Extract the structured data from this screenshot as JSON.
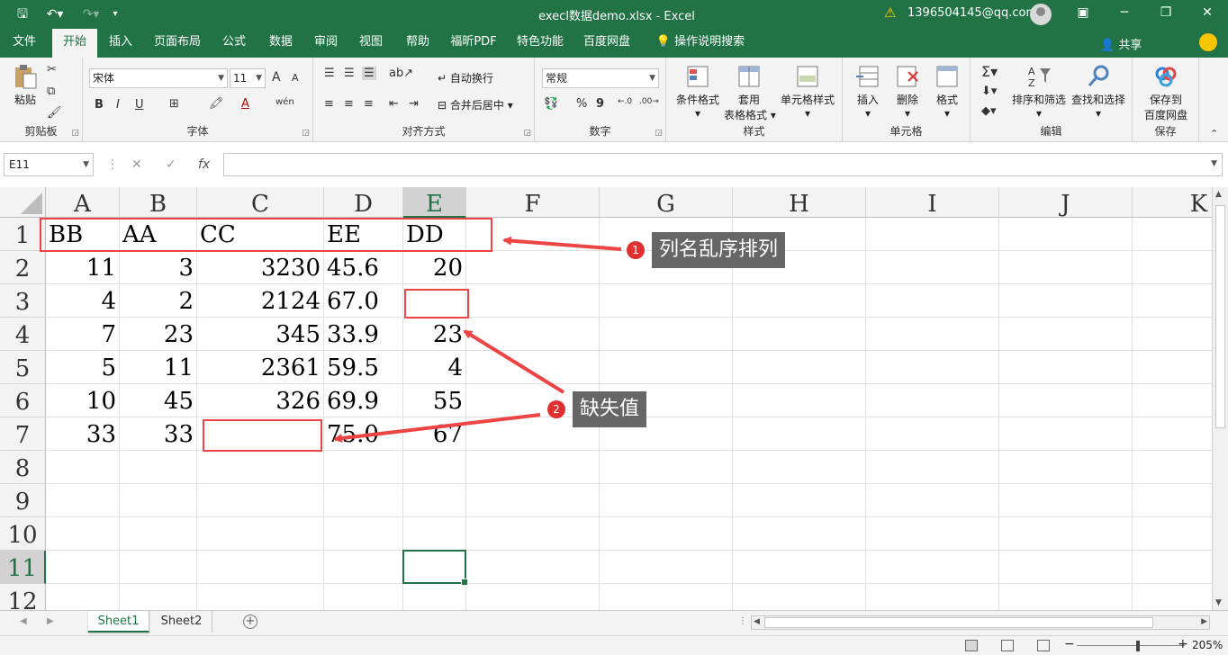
{
  "titlebar": {
    "title": "execl数据demo.xlsx  -  Excel",
    "user": "1396504145@qq.com",
    "min_glyph": "─",
    "restore_glyph": "❐",
    "close_glyph": "✕"
  },
  "menu": {
    "tabs": [
      "文件",
      "开始",
      "插入",
      "页面布局",
      "公式",
      "数据",
      "审阅",
      "视图",
      "帮助",
      "福昕PDF",
      "特色功能",
      "百度网盘",
      "操作说明搜索"
    ],
    "active": "开始",
    "share": "共享"
  },
  "ribbon": {
    "clipboard": {
      "label": "剪贴板",
      "paste": "粘贴"
    },
    "font": {
      "label": "字体",
      "name": "宋体",
      "size": "11",
      "bold": "B",
      "italic": "I",
      "underline": "U",
      "grow": "A",
      "shrink": "A",
      "wen": "wén"
    },
    "alignment": {
      "label": "对齐方式",
      "wrap": "自动换行",
      "merge": "合并后居中"
    },
    "number": {
      "label": "数字",
      "format": "常规",
      "percent": "%",
      "comma": "9"
    },
    "styles": {
      "label": "样式",
      "conditional": "条件格式",
      "table_line1": "套用",
      "table_line2": "表格格式",
      "cell_styles": "单元格样式"
    },
    "cells": {
      "label": "单元格",
      "insert": "插入",
      "delete": "删除",
      "format": "格式"
    },
    "editing": {
      "label": "编辑",
      "sort": "排序和筛选",
      "find": "查找和选择"
    },
    "save": {
      "label": "保存",
      "line1": "保存到",
      "line2": "百度网盘"
    }
  },
  "formula_bar": {
    "name_box": "E11",
    "cancel": "✕",
    "enter": "✓",
    "fx": "fx",
    "value": ""
  },
  "grid": {
    "columns": [
      "A",
      "B",
      "C",
      "D",
      "E",
      "F",
      "G",
      "H",
      "I",
      "J",
      "K"
    ],
    "rows": [
      "1",
      "2",
      "3",
      "4",
      "5",
      "6",
      "7",
      "8",
      "9",
      "10",
      "11",
      "12"
    ],
    "selected_col": "E",
    "selected_row": "11",
    "cells": [
      [
        "BB",
        "AA",
        "CC",
        "EE",
        "DD"
      ],
      [
        "11",
        "3",
        "3230",
        "45.6",
        "20"
      ],
      [
        "4",
        "2",
        "2124",
        "67.0",
        ""
      ],
      [
        "7",
        "23",
        "345",
        "33.9",
        "23"
      ],
      [
        "5",
        "11",
        "2361",
        "59.5",
        "4"
      ],
      [
        "10",
        "45",
        "326",
        "69.9",
        "55"
      ],
      [
        "33",
        "33",
        "",
        "75.0",
        "67"
      ]
    ]
  },
  "annotations": {
    "callout1": {
      "badge": "1",
      "text": "列名乱序排列"
    },
    "callout2": {
      "badge": "2",
      "text": "缺失值"
    },
    "color": "#ef4444"
  },
  "sheets": {
    "tabs": [
      "Sheet1",
      "Sheet2"
    ],
    "active": "Sheet1"
  },
  "status": {
    "zoom": "205%"
  }
}
